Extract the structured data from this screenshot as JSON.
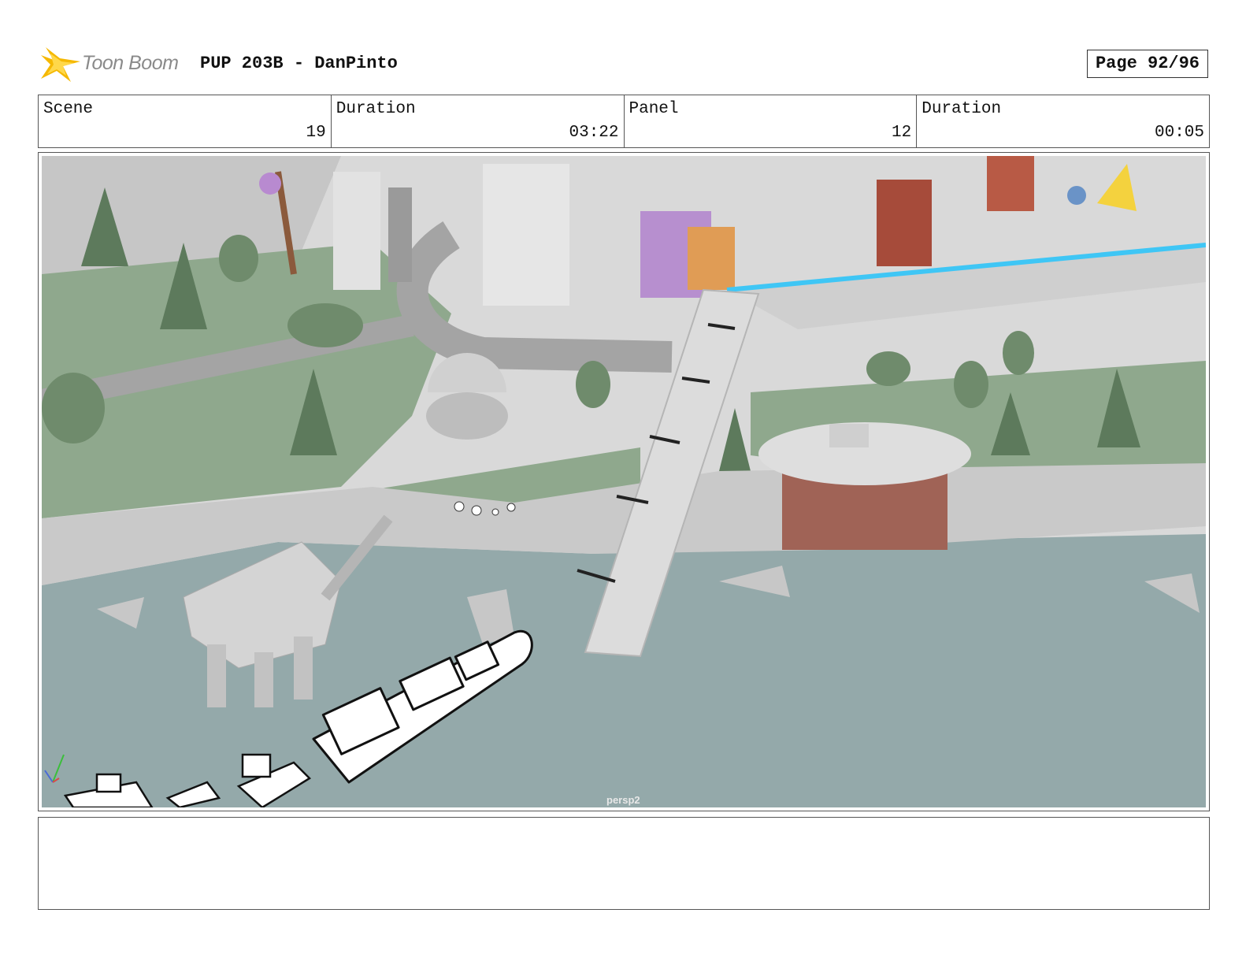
{
  "header": {
    "logo_text": "Toon Boom",
    "title": "PUP 203B - DanPinto",
    "page": "Page 92/96"
  },
  "info": {
    "scene_label": "Scene",
    "scene_value": "19",
    "duration_label": "Duration",
    "duration_value": "03:22",
    "panel_label": "Panel",
    "panel_value": "12",
    "panel_duration_label": "Duration",
    "panel_duration_value": "00:05"
  },
  "panel": {
    "camera_label": "persp2"
  },
  "notes": {
    "text": ""
  },
  "colors": {
    "water": "#94a9aa",
    "grass": "#8fa88d",
    "ground": "#d4d4d4",
    "bridge_glow": "#3fc6f5",
    "logo_star": "#f5b800"
  }
}
